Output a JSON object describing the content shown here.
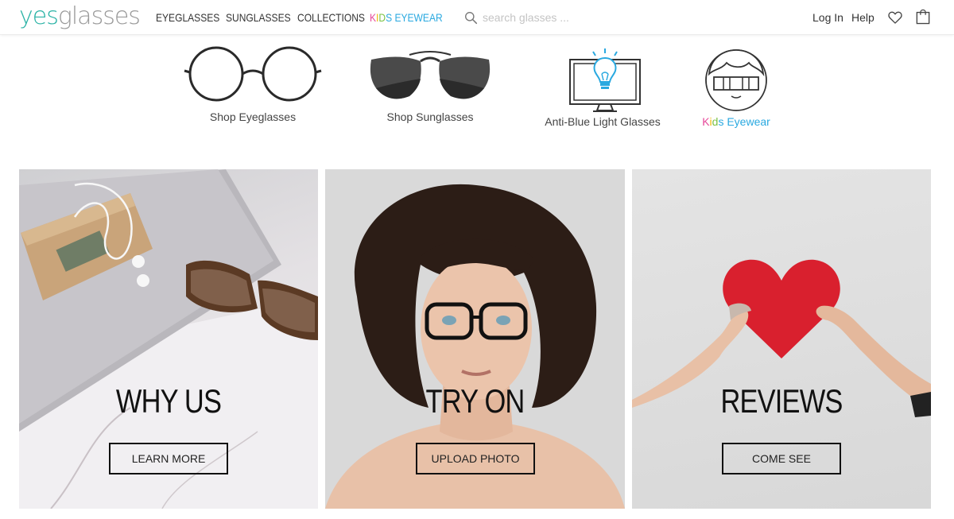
{
  "brand": {
    "logo_part1": "yes",
    "logo_part2": "glasses"
  },
  "nav": {
    "items": [
      {
        "label": "EYEGLASSES"
      },
      {
        "label": "SUNGLASSES"
      },
      {
        "label": "COLLECTIONS"
      }
    ],
    "kids": {
      "letters": [
        "K",
        "I",
        "D",
        "S"
      ],
      "rest": "EYEWEAR"
    }
  },
  "search": {
    "placeholder": "search glasses ...",
    "icon": "search-icon"
  },
  "header": {
    "login": "Log In",
    "help": "Help",
    "wishlist_icon": "heart-icon",
    "cart_icon": "bag-icon"
  },
  "categories": [
    {
      "label": "Shop Eyeglasses",
      "icon": "eyeglasses-icon"
    },
    {
      "label": "Shop Sunglasses",
      "icon": "sunglasses-icon"
    },
    {
      "label": "Anti-Blue Light Glasses",
      "icon": "monitor-lightbulb-icon"
    },
    {
      "label_kids": [
        "K",
        "i",
        "d",
        "s"
      ],
      "label_rest": "Eyewear",
      "icon": "kid-face-icon"
    }
  ],
  "kids_colors": [
    "#e6499a",
    "#f2b705",
    "#7ac143",
    "#2aa9e0"
  ],
  "tiles": [
    {
      "title": "WHY US",
      "button": "LEARN MORE"
    },
    {
      "title": "TRY ON",
      "button": "UPLOAD PHOTO"
    },
    {
      "title": "REVIEWS",
      "button": "COME SEE"
    }
  ],
  "colors": {
    "brand_teal": "#2bb3a6",
    "kids_eyewear": "#2aa9e0",
    "heart_red": "#d9202e"
  }
}
